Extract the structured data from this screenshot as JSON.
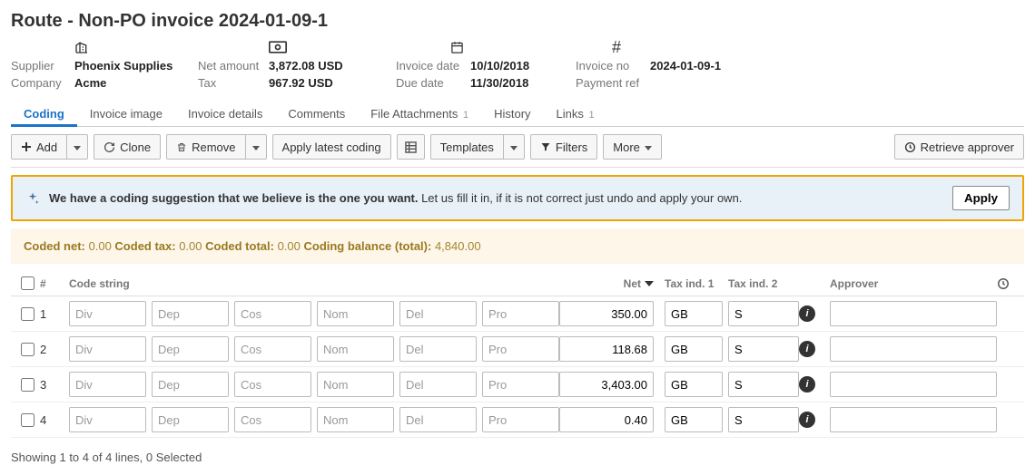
{
  "title": "Route - Non-PO invoice 2024-01-09-1",
  "meta": {
    "supplier_label": "Supplier",
    "supplier": "Phoenix Supplies",
    "company_label": "Company",
    "company": "Acme",
    "netamount_label": "Net amount",
    "netamount": "3,872.08 USD",
    "tax_label": "Tax",
    "tax": "967.92 USD",
    "invoicedate_label": "Invoice date",
    "invoicedate": "10/10/2018",
    "duedate_label": "Due date",
    "duedate": "11/30/2018",
    "invoiceno_label": "Invoice no",
    "invoiceno": "2024-01-09-1",
    "paymentref_label": "Payment ref",
    "paymentref": ""
  },
  "tabs": {
    "coding": "Coding",
    "image": "Invoice image",
    "details": "Invoice details",
    "comments": "Comments",
    "files": "File Attachments",
    "files_count": "1",
    "history": "History",
    "links": "Links",
    "links_count": "1"
  },
  "toolbar": {
    "add": "Add",
    "clone": "Clone",
    "remove": "Remove",
    "apply_latest": "Apply latest coding",
    "templates": "Templates",
    "filters": "Filters",
    "more": "More",
    "retrieve": "Retrieve approver"
  },
  "suggestion": {
    "bold": "We have a coding suggestion that we believe is the one you want.",
    "rest": " Let us fill it in, if it is not correct just undo and apply your own.",
    "apply": "Apply"
  },
  "totals": {
    "codednet_l": "Coded net:",
    "codednet_v": " 0.00 ",
    "codedtax_l": "Coded tax:",
    "codedtax_v": " 0.00 ",
    "codedtotal_l": "Coded total:",
    "codedtotal_v": " 0.00 ",
    "balance_l": "Coding balance (total):",
    "balance_v": " 4,840.00"
  },
  "grid": {
    "headers": {
      "num": "#",
      "cs": "Code string",
      "net": "Net",
      "tax1": "Tax ind. 1",
      "tax2": "Tax ind. 2",
      "approver": "Approver"
    },
    "placeholders": {
      "div": "Div",
      "dep": "Dep",
      "cos": "Cos",
      "nom": "Nom",
      "del": "Del",
      "pro": "Pro"
    },
    "rows": [
      {
        "num": "1",
        "net": "350.00",
        "tax1": "GB",
        "tax2": "S",
        "approver": ""
      },
      {
        "num": "2",
        "net": "118.68",
        "tax1": "GB",
        "tax2": "S",
        "approver": ""
      },
      {
        "num": "3",
        "net": "3,403.00",
        "tax1": "GB",
        "tax2": "S",
        "approver": ""
      },
      {
        "num": "4",
        "net": "0.40",
        "tax1": "GB",
        "tax2": "S",
        "approver": ""
      }
    ]
  },
  "footer": "Showing 1 to 4 of 4 lines,  0 Selected"
}
